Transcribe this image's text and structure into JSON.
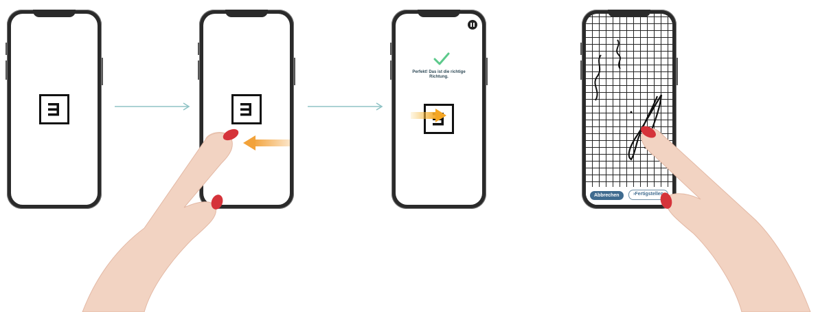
{
  "steps": [
    {
      "id": "step-1"
    },
    {
      "id": "step-2"
    },
    {
      "id": "step-3",
      "feedback_text": "Perfekt! Das ist die richtige Richtung."
    },
    {
      "id": "step-4",
      "cancel_label": "Abbrechen",
      "finish_label": "›Fertigstellen"
    }
  ],
  "colors": {
    "connector": "#8fc3c5",
    "swipe_arrow": "#f2a23a",
    "check": "#5cc98b",
    "primary": "#3f6b8f",
    "nail": "#d5333a",
    "skin": "#f2d3c2"
  },
  "icons": [
    "e-glyph-icon",
    "swipe-left-arrow-icon",
    "checkmark-icon",
    "pause-icon",
    "arrow-right-icon"
  ]
}
